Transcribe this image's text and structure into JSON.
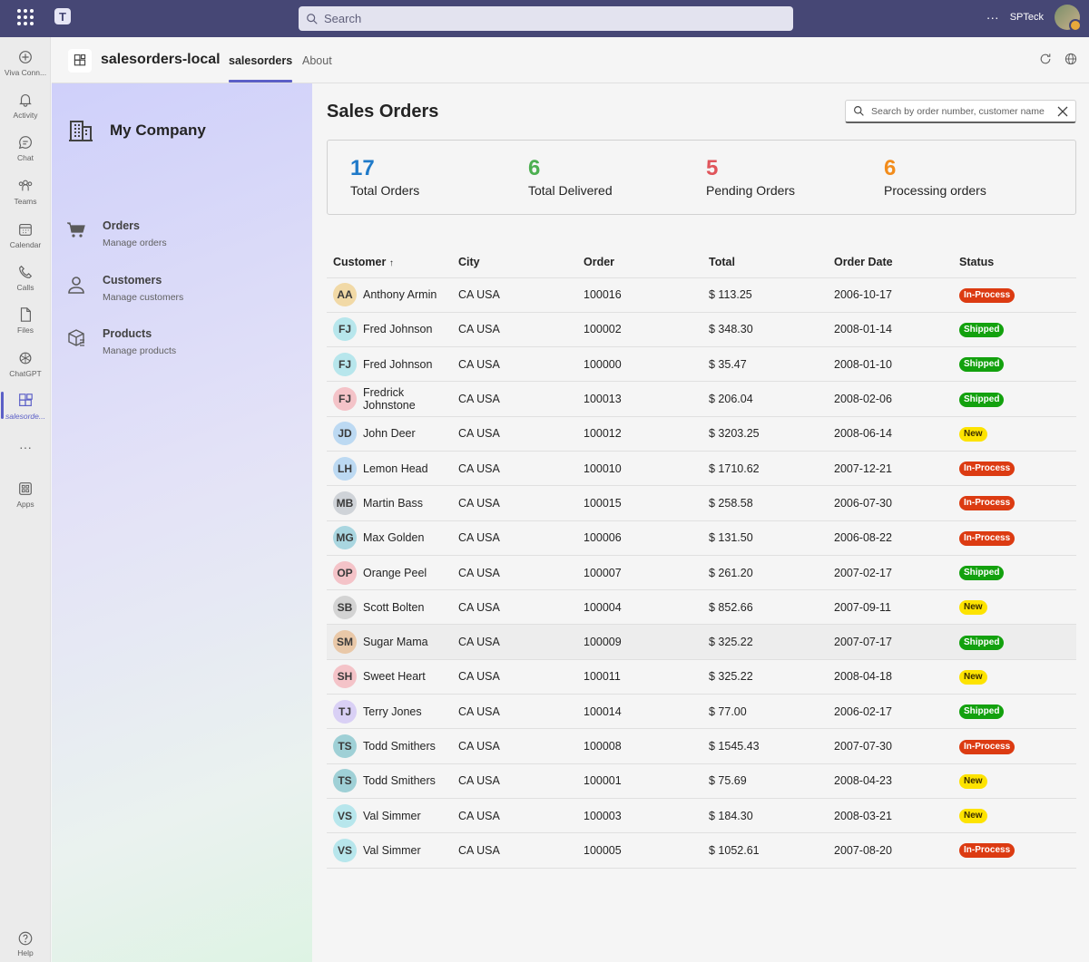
{
  "topbar": {
    "search_placeholder": "Search",
    "user_name": "SPTeck",
    "more": "···"
  },
  "rail": {
    "items": [
      {
        "label": "Viva Conn...",
        "icon": "viva-connections-icon"
      },
      {
        "label": "Activity",
        "icon": "bell-icon"
      },
      {
        "label": "Chat",
        "icon": "chat-icon"
      },
      {
        "label": "Teams",
        "icon": "teams-icon"
      },
      {
        "label": "Calendar",
        "icon": "calendar-icon"
      },
      {
        "label": "Calls",
        "icon": "phone-icon"
      },
      {
        "label": "Files",
        "icon": "file-icon"
      },
      {
        "label": "ChatGPT",
        "icon": "chatgpt-icon"
      },
      {
        "label": "salesorde...",
        "icon": "app-icon"
      },
      {
        "label": "···",
        "icon": "more-icon"
      },
      {
        "label": "Apps",
        "icon": "apps-icon"
      }
    ],
    "help": "Help"
  },
  "header": {
    "app_name": "salesorders-local",
    "tabs": [
      {
        "label": "salesorders"
      },
      {
        "label": "About"
      }
    ]
  },
  "leftnav": {
    "company": "My Company",
    "items": [
      {
        "title": "Orders",
        "subtitle": "Manage orders"
      },
      {
        "title": "Customers",
        "subtitle": "Manage customers"
      },
      {
        "title": "Products",
        "subtitle": "Manage products"
      }
    ]
  },
  "main": {
    "title": "Sales Orders",
    "search_placeholder": "Search by order number, customer name",
    "kpis": [
      {
        "value": "17",
        "label": "Total Orders",
        "color": "#1f7ac9"
      },
      {
        "value": "6",
        "label": "Total Delivered",
        "color": "#4caf50"
      },
      {
        "value": "5",
        "label": "Pending Orders",
        "color": "#e0555b"
      },
      {
        "value": "6",
        "label": "Processing orders",
        "color": "#f28c1b"
      }
    ],
    "columns": [
      "Customer",
      "City",
      "Order",
      "Total",
      "Order Date",
      "Status"
    ],
    "sort_indicator": "↑",
    "rows": [
      {
        "initials": "AA",
        "customer": "Anthony Armin",
        "city": "CA USA",
        "order": "100016",
        "total": "$ 113.25",
        "date": "2006-10-17",
        "status": "In-Process",
        "av": "#f1d9a6"
      },
      {
        "initials": "FJ",
        "customer": "Fred Johnson",
        "city": "CA USA",
        "order": "100002",
        "total": "$ 348.30",
        "date": "2008-01-14",
        "status": "Shipped",
        "av": "#b7e6ec"
      },
      {
        "initials": "FJ",
        "customer": "Fred Johnson",
        "city": "CA USA",
        "order": "100000",
        "total": "$ 35.47",
        "date": "2008-01-10",
        "status": "Shipped",
        "av": "#b7e6ec"
      },
      {
        "initials": "FJ",
        "customer": "Fredrick Johnstone",
        "city": "CA USA",
        "order": "100013",
        "total": "$ 206.04",
        "date": "2008-02-06",
        "status": "Shipped",
        "av": "#f4c3c8"
      },
      {
        "initials": "JD",
        "customer": "John Deer",
        "city": "CA USA",
        "order": "100012",
        "total": "$ 3203.25",
        "date": "2008-06-14",
        "status": "New",
        "av": "#bcd9f2"
      },
      {
        "initials": "LH",
        "customer": "Lemon Head",
        "city": "CA USA",
        "order": "100010",
        "total": "$ 1710.62",
        "date": "2007-12-21",
        "status": "In-Process",
        "av": "#bcd9f2"
      },
      {
        "initials": "MB",
        "customer": "Martin Bass",
        "city": "CA USA",
        "order": "100015",
        "total": "$ 258.58",
        "date": "2006-07-30",
        "status": "In-Process",
        "av": "#cfd3d8"
      },
      {
        "initials": "MG",
        "customer": "Max Golden",
        "city": "CA USA",
        "order": "100006",
        "total": "$ 131.50",
        "date": "2006-08-22",
        "status": "In-Process",
        "av": "#a9d6e0"
      },
      {
        "initials": "OP",
        "customer": "Orange Peel",
        "city": "CA USA",
        "order": "100007",
        "total": "$ 261.20",
        "date": "2007-02-17",
        "status": "Shipped",
        "av": "#f4c3c8"
      },
      {
        "initials": "SB",
        "customer": "Scott Bolten",
        "city": "CA USA",
        "order": "100004",
        "total": "$ 852.66",
        "date": "2007-09-11",
        "status": "New",
        "av": "#d3d3d3"
      },
      {
        "initials": "SM",
        "customer": "Sugar Mama",
        "city": "CA USA",
        "order": "100009",
        "total": "$ 325.22",
        "date": "2007-07-17",
        "status": "Shipped",
        "av": "#e9c8a8"
      },
      {
        "initials": "SH",
        "customer": "Sweet Heart",
        "city": "CA USA",
        "order": "100011",
        "total": "$ 325.22",
        "date": "2008-04-18",
        "status": "New",
        "av": "#f4c3c8"
      },
      {
        "initials": "TJ",
        "customer": "Terry Jones",
        "city": "CA USA",
        "order": "100014",
        "total": "$ 77.00",
        "date": "2006-02-17",
        "status": "Shipped",
        "av": "#d9d0f5"
      },
      {
        "initials": "TS",
        "customer": "Todd Smithers",
        "city": "CA USA",
        "order": "100008",
        "total": "$ 1545.43",
        "date": "2007-07-30",
        "status": "In-Process",
        "av": "#9fd0d6"
      },
      {
        "initials": "TS",
        "customer": "Todd Smithers",
        "city": "CA USA",
        "order": "100001",
        "total": "$ 75.69",
        "date": "2008-04-23",
        "status": "New",
        "av": "#9fd0d6"
      },
      {
        "initials": "VS",
        "customer": "Val Simmer",
        "city": "CA USA",
        "order": "100003",
        "total": "$ 184.30",
        "date": "2008-03-21",
        "status": "New",
        "av": "#b7e6ec"
      },
      {
        "initials": "VS",
        "customer": "Val Simmer",
        "city": "CA USA",
        "order": "100005",
        "total": "$ 1052.61",
        "date": "2007-08-20",
        "status": "In-Process",
        "av": "#b7e6ec"
      }
    ],
    "status_colors": {
      "In-Process": {
        "bg": "#dc3b12",
        "fg": "#ffffff"
      },
      "Shipped": {
        "bg": "#13a10e",
        "fg": "#ffffff"
      },
      "New": {
        "bg": "#fde300",
        "fg": "#3b2e00"
      }
    }
  },
  "colors": {
    "brand": "#464775",
    "accent": "#5b5fc7"
  }
}
